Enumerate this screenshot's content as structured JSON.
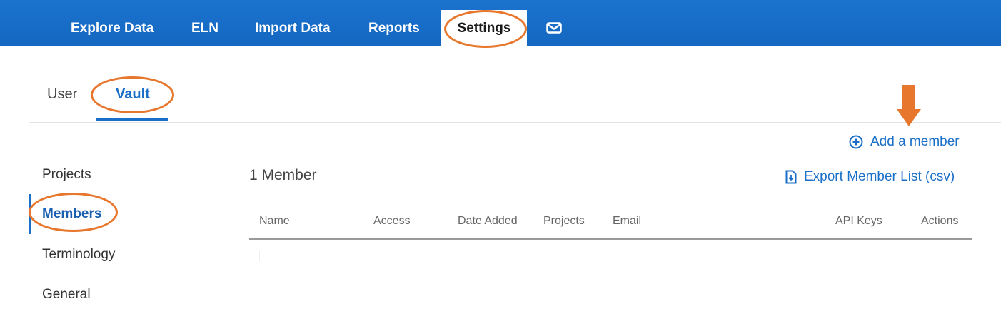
{
  "topnav": {
    "items": [
      "Explore Data",
      "ELN",
      "Import Data",
      "Reports"
    ],
    "active": "Settings",
    "mail_icon": "mail-icon"
  },
  "tabs": {
    "user": "User",
    "vault": "Vault",
    "active": "Vault"
  },
  "sidebar": {
    "items": [
      "Projects",
      "Members",
      "Terminology",
      "General"
    ],
    "active": "Members"
  },
  "main": {
    "add_member": "Add a member",
    "member_count": "1 Member",
    "export": "Export Member List (csv)",
    "columns": [
      "Name",
      "Access",
      "Date Added",
      "Projects",
      "Email",
      "API Keys",
      "Actions"
    ]
  },
  "colors": {
    "brand": "#1a6fc8",
    "annotation": "#e8772e"
  }
}
